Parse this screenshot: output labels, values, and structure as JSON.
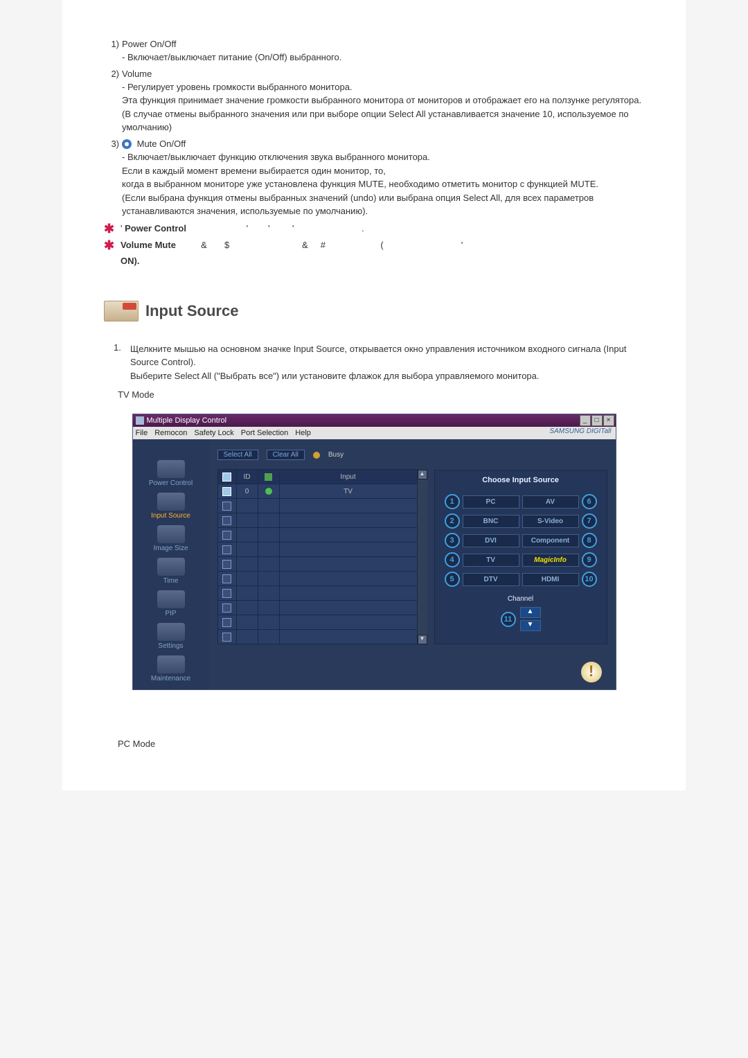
{
  "list": {
    "item1": {
      "num": "1)",
      "title": "Power On/Off",
      "dash": "- Включает/выключает питание (On/Off)  выбранного."
    },
    "item2": {
      "num": "2)",
      "title": "Volume",
      "p1": "- Регулирует уровень громкости выбранного монитора.",
      "p2": "Эта функция принимает значение громкости выбранного монитора от мониторов и отображает его на ползунке регулятора.",
      "p3": "(В случае отмены выбранного значения или при выборе опции Select All устанавливается значение 10, используемое по умолчанию)"
    },
    "item3": {
      "num": "3)",
      "title": "Mute On/Off",
      "p1": "- Включает/выключает функцию отключения звука выбранного монитора.",
      "p2": "Если в каждый момент времени выбирается один монитор, то,",
      "p3": "когда в выбранном мониторе уже установлена функция MUTE, необходимо отметить монитор с функцией MUTE.",
      "p4": "(Если выбрана функция отмены выбранных значений (undo)  или выбрана опция Select All, для всех параметров устанавливаются значения, используемые по умолчанию)."
    }
  },
  "star1": {
    "pre": "' ",
    "bold": "Power Control",
    "rest": "                       '        '         '                           ."
  },
  "star2": {
    "bold": "Volume    Mute",
    "rest": "         &       $                             &     #                      (                               '",
    "on": "ON)."
  },
  "section": {
    "title": "Input Source"
  },
  "instruction": {
    "num": "1.",
    "p1": "Щелкните мышью на основном значке Input Source, открывается окно управления источником входного сигнала (Input Source Control).",
    "p2": "Выберите Select All (\"Выбрать все\") или установите флажок для выбора управляемого монитора."
  },
  "tvmode": "TV Mode",
  "pcmode": "PC Mode",
  "app": {
    "title": "Multiple Display Control",
    "menu": {
      "file": "File",
      "remocon": "Remocon",
      "safety": "Safety Lock",
      "port": "Port Selection",
      "help": "Help"
    },
    "logo": "SAMSUNG DIGITall",
    "sidebar": {
      "power": "Power Control",
      "input": "Input Source",
      "image": "Image Size",
      "time": "Time",
      "pip": "PIP",
      "settings": "Settings",
      "maint": "Maintenance"
    },
    "toolbar": {
      "selectall": "Select All",
      "clearall": "Clear All",
      "busy": "Busy"
    },
    "grid": {
      "h_chk": "",
      "h_id": "ID",
      "h_st": "",
      "h_input": "Input",
      "row0_id": "0",
      "row0_input": "TV"
    },
    "panel": {
      "title": "Choose Input Source",
      "pc": "PC",
      "bnc": "BNC",
      "dvi": "DVI",
      "tv": "TV",
      "dtv": "DTV",
      "av": "AV",
      "svideo": "S-Video",
      "component": "Component",
      "magic": "MagicInfo",
      "hdmi": "HDMI",
      "n1": "1",
      "n2": "2",
      "n3": "3",
      "n4": "4",
      "n5": "5",
      "n6": "6",
      "n7": "7",
      "n8": "8",
      "n9": "9",
      "n10": "10",
      "n11": "11",
      "channel": "Channel"
    }
  }
}
